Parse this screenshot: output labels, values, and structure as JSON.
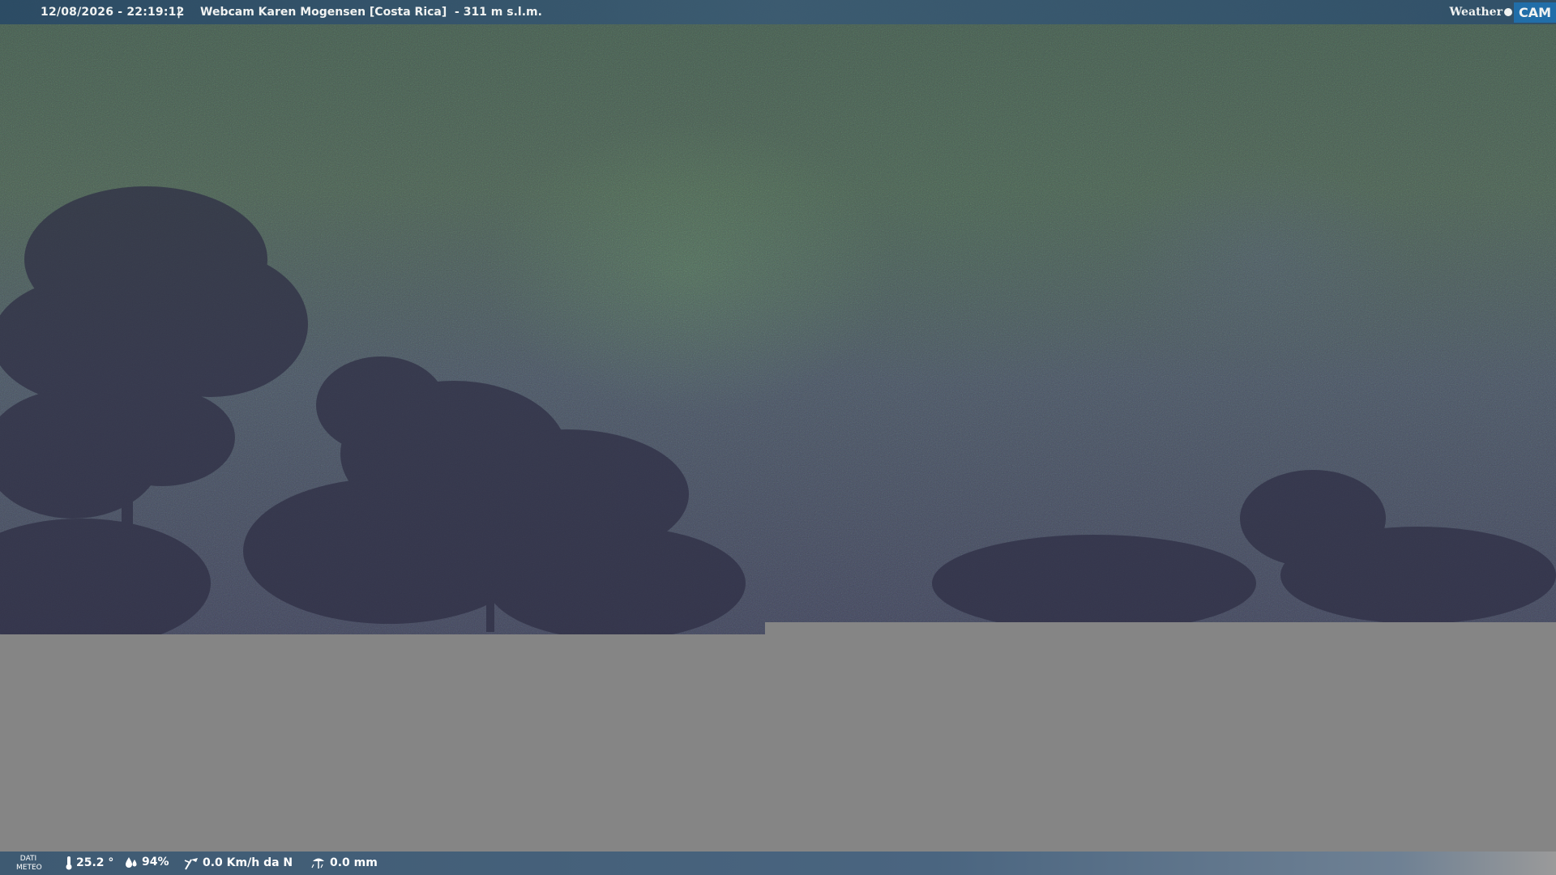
{
  "header": {
    "timestamp": "12/08/2026 - 22:19:12",
    "separator": "|",
    "title": "Webcam Karen Mogensen [Costa Rica]  - 311 m s.l.m."
  },
  "logo": {
    "weather_text": "Weather",
    "cam_text": "CAM"
  },
  "footer": {
    "label_line1": "DATI",
    "label_line2": "METEO",
    "temperature": "25.2 °",
    "humidity": "94%",
    "wind": "0.0 Km/h da N",
    "rain": "0.0 mm"
  },
  "colors": {
    "top_bar": "#2a4a66",
    "bottom_bar": "#3e5a72",
    "gray_area": "#858585",
    "logo_cam": "#1e6fb0"
  },
  "icons": {
    "temperature": "thermometer-icon",
    "humidity": "humidity-drops-icon",
    "wind": "wind-icon",
    "rain": "rain-gauge-icon"
  }
}
